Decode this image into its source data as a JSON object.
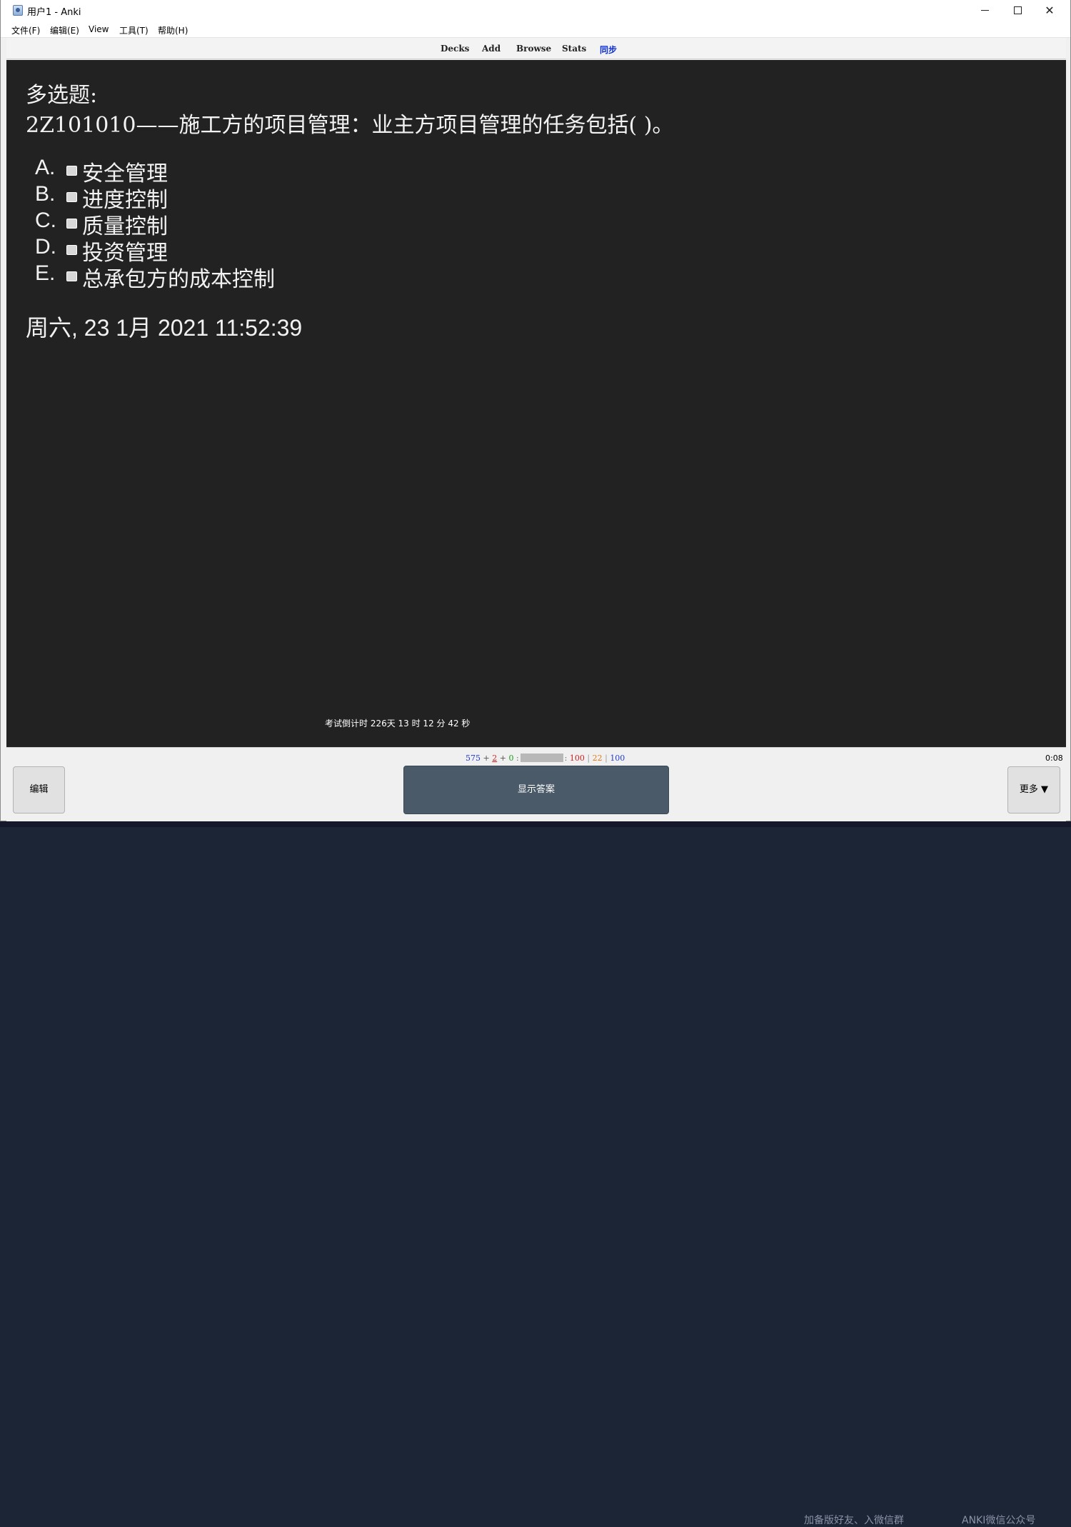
{
  "window": {
    "title": "用户1 - Anki",
    "minimize": "",
    "maximize": "",
    "close": "✕"
  },
  "menu": [
    "文件(F)",
    "编辑(E)",
    "View",
    "工具(T)",
    "帮助(H)"
  ],
  "toolbar": {
    "decks": "Decks",
    "add": "Add",
    "browse": "Browse",
    "stats": "Stats",
    "sync": "同步"
  },
  "card": {
    "type_label": "多选题:",
    "question": "2Z101010——施工方的项目管理：业主方项目管理的任务包括( )。",
    "options": [
      {
        "letter": "A.",
        "text": "安全管理"
      },
      {
        "letter": "B.",
        "text": "进度控制"
      },
      {
        "letter": "C.",
        "text": "质量控制"
      },
      {
        "letter": "D.",
        "text": "投资管理"
      },
      {
        "letter": "E.",
        "text": "总承包方的成本控制"
      }
    ],
    "clock": "周六, 23 1月 2021 11:52:39",
    "countdown": "考试倒计时 226天 13 时 12 分 42 秒"
  },
  "bottom": {
    "new_count": "575",
    "plus1": "+",
    "learn_count": "2",
    "plus2": "+",
    "review_count": "0",
    "colon1": ":",
    "colon2": ":",
    "stat_a": "100",
    "stat_b": "22",
    "stat_c": "100",
    "sep": "|",
    "timer": "0:08",
    "edit_label": "编辑",
    "show_answer_label": "显示答案",
    "more_label": "更多 ▼"
  },
  "background_text": {
    "left": "加备版好友、入微信群",
    "right": "ANKI微信公众号"
  },
  "colors": {
    "reviewer_bg": "#222222",
    "show_answer_bg": "#4a5a68",
    "sync_link": "#0b2fd6",
    "new_count": "#1f3cd6",
    "learn_count": "#d02020",
    "review_count": "#1a9a1a"
  }
}
